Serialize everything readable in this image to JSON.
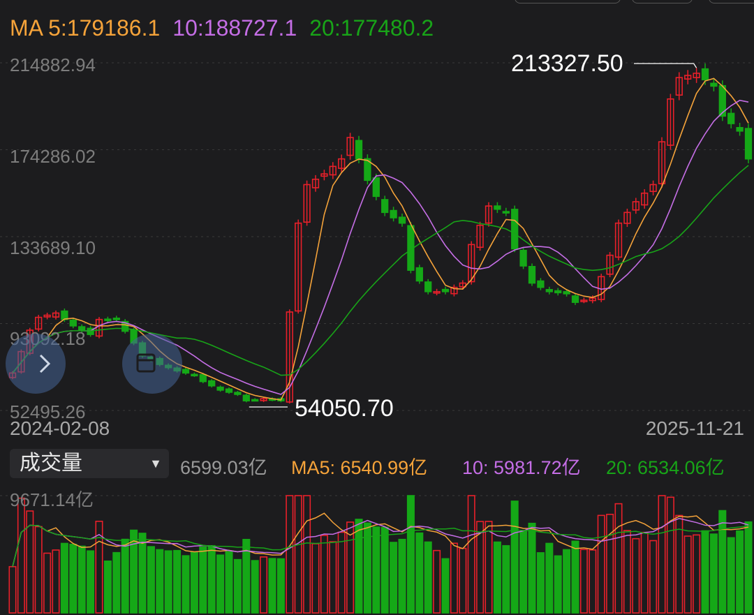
{
  "ma_legend": {
    "ma5": "MA 5:179186.1",
    "ma10": "10:188727.1",
    "ma20": "20:177480.2"
  },
  "colors": {
    "ma5": "#f5a33a",
    "ma10": "#c56ee6",
    "ma20": "#18a418",
    "up": "#e8202a",
    "down": "#15a817",
    "grid": "#3a3a3a"
  },
  "price_axis_labels": [
    "214882.94",
    "174286.02",
    "133689.10",
    "93092.18",
    "52495.26"
  ],
  "price_axis": {
    "max": 214882.94,
    "min": 52495.26
  },
  "high_callout": "213327.50",
  "low_callout": "54050.70",
  "date_start": "2024-02-08",
  "date_end": "2025-11-21",
  "volume_panel": {
    "indicator": "成交量",
    "current": "6599.03亿",
    "ma5": "MA5: 6540.99亿",
    "ma10": "10: 5981.72亿",
    "ma20": "20: 6534.06亿",
    "max_label": "9671.14亿",
    "max_value": 9671.14
  },
  "icons": {
    "nav_prev": "chevron-icon",
    "nav_next": "calendar-icon",
    "dropdown": "caret-down-icon"
  },
  "chart_data": {
    "type": "candlestick",
    "period_count": 86,
    "x_range": [
      "2024-02-08",
      "2025-11-21"
    ],
    "ylim": [
      52495.26,
      214882.94
    ],
    "close_anchors": [
      [
        0,
        70000
      ],
      [
        2,
        90000
      ],
      [
        4,
        96000
      ],
      [
        6,
        98000
      ],
      [
        8,
        92000
      ],
      [
        10,
        88000
      ],
      [
        12,
        95000
      ],
      [
        14,
        95000
      ],
      [
        16,
        84000
      ],
      [
        18,
        78000
      ],
      [
        20,
        74000
      ],
      [
        22,
        71000
      ],
      [
        24,
        69000
      ],
      [
        26,
        66000
      ],
      [
        28,
        62000
      ],
      [
        30,
        60000
      ],
      [
        32,
        57000
      ],
      [
        34,
        58000
      ],
      [
        36,
        57000
      ],
      [
        38,
        140000
      ],
      [
        40,
        158000
      ],
      [
        42,
        163000
      ],
      [
        44,
        170000
      ],
      [
        46,
        180000
      ],
      [
        48,
        160000
      ],
      [
        50,
        145000
      ],
      [
        52,
        140000
      ],
      [
        54,
        118000
      ],
      [
        56,
        108000
      ],
      [
        58,
        108000
      ],
      [
        60,
        112000
      ],
      [
        62,
        130000
      ],
      [
        64,
        148000
      ],
      [
        66,
        145000
      ],
      [
        68,
        128000
      ],
      [
        70,
        112000
      ],
      [
        72,
        108000
      ],
      [
        74,
        107000
      ],
      [
        76,
        103000
      ],
      [
        78,
        105000
      ],
      [
        80,
        125000
      ],
      [
        82,
        140000
      ],
      [
        84,
        150000
      ],
      [
        86,
        158000
      ],
      [
        88,
        198000
      ],
      [
        90,
        208000
      ],
      [
        92,
        210000
      ],
      [
        94,
        204000
      ],
      [
        96,
        190000
      ],
      [
        98,
        183000
      ],
      [
        99,
        170000
      ]
    ],
    "ma_lines": [
      "MA5",
      "MA10",
      "MA20"
    ],
    "volume_unit": "亿",
    "volume_max": 9671.14
  }
}
